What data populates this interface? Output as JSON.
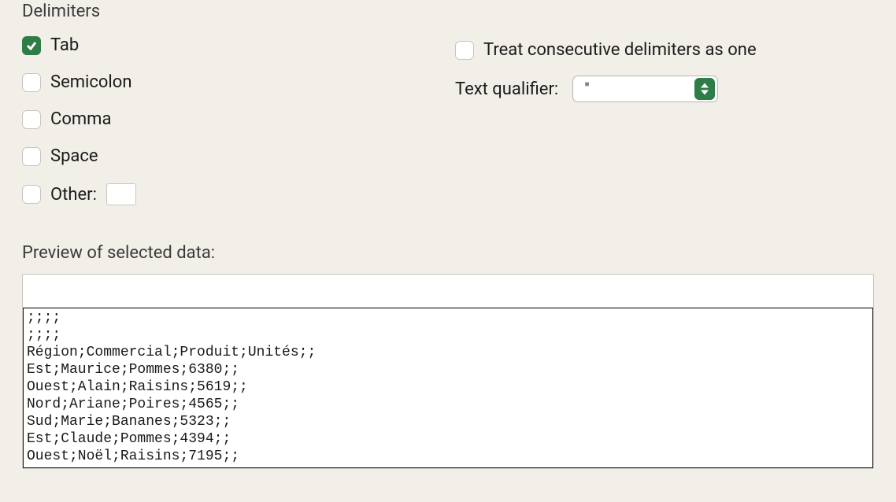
{
  "delimiters": {
    "heading": "Delimiters",
    "tab": {
      "label": "Tab",
      "checked": true
    },
    "semicolon": {
      "label": "Semicolon",
      "checked": false
    },
    "comma": {
      "label": "Comma",
      "checked": false
    },
    "space": {
      "label": "Space",
      "checked": false
    },
    "other": {
      "label": "Other:",
      "checked": false,
      "value": ""
    },
    "treat_consecutive": {
      "label": "Treat consecutive delimiters as one",
      "checked": false
    },
    "text_qualifier": {
      "label": "Text qualifier:",
      "value": "\""
    }
  },
  "preview": {
    "heading": "Preview of selected data:",
    "lines": [
      ";;;;",
      ";;;;",
      "Région;Commercial;Produit;Unités;;",
      "Est;Maurice;Pommes;6380;;",
      "Ouest;Alain;Raisins;5619;;",
      "Nord;Ariane;Poires;4565;;",
      "Sud;Marie;Bananes;5323;;",
      "Est;Claude;Pommes;4394;;",
      "Ouest;Noël;Raisins;7195;;"
    ]
  }
}
